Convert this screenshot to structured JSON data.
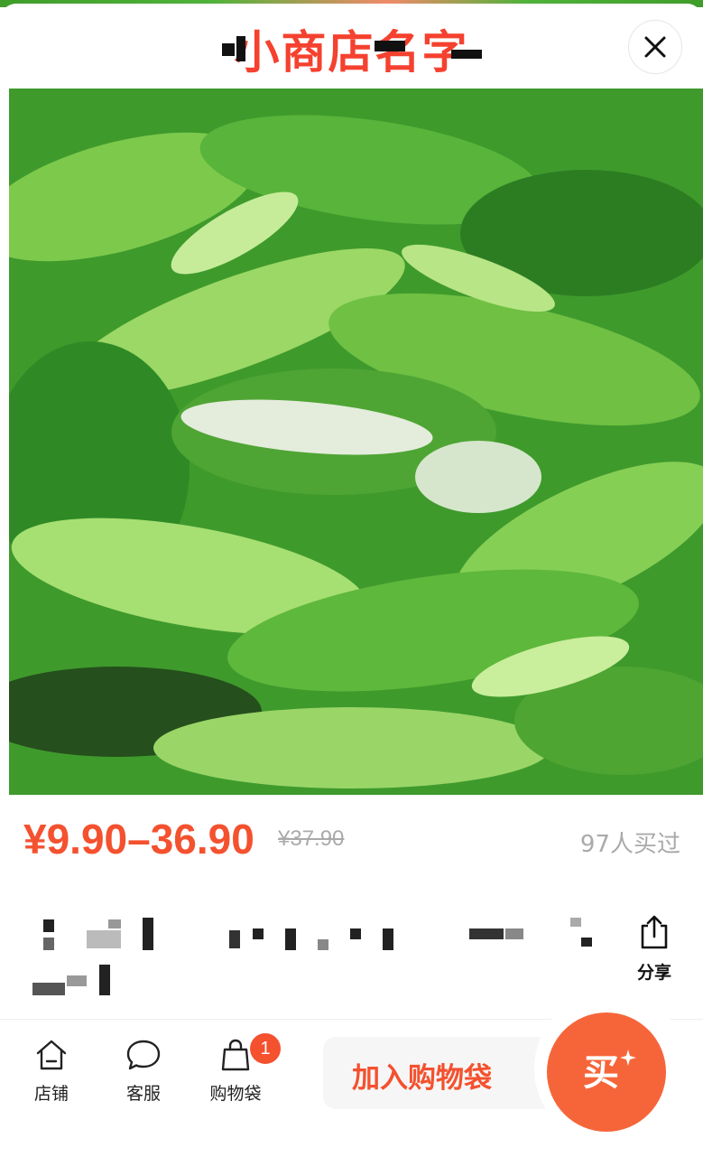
{
  "header": {
    "shop_name": "小商店名字"
  },
  "product": {
    "price": "¥9.90–36.90",
    "original_price": "¥37.90",
    "sold_count": "97人买过"
  },
  "actions": {
    "share_label": "分享",
    "add_to_bag_label": "加入购物袋",
    "buy_label": "买"
  },
  "tabbar": {
    "items": [
      {
        "label": "店铺",
        "icon": "home-icon"
      },
      {
        "label": "客服",
        "icon": "chat-bubble-icon"
      },
      {
        "label": "购物袋",
        "icon": "shopping-bag-icon",
        "badge": "1"
      }
    ]
  },
  "colors": {
    "accent": "#f4512f",
    "buy_button": "#f6653a",
    "muted_text": "#aaaaaa"
  }
}
